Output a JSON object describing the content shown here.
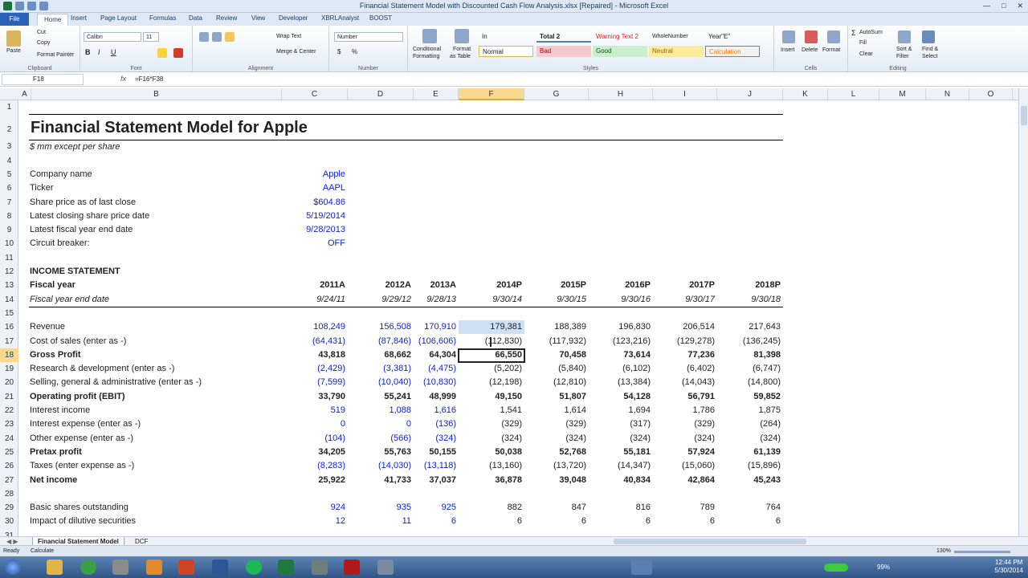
{
  "window": {
    "title": "Financial Statement Model with Discounted Cash Flow Analysis.xlsx [Repaired]  -  Microsoft Excel"
  },
  "ribbon": {
    "tabs": [
      "File",
      "Home",
      "Insert",
      "Page Layout",
      "Formulas",
      "Data",
      "Review",
      "View",
      "Developer",
      "XBRLAnalyst",
      "BOOST"
    ],
    "clipboard": {
      "paste": "Paste",
      "cut": "Cut",
      "copy": "Copy",
      "format_painter": "Format Painter",
      "label": "Clipboard"
    },
    "font": {
      "name": "Calibri",
      "size": "11",
      "label": "Font"
    },
    "alignment": {
      "wrap_text": "Wrap Text",
      "merge_center": "Merge & Center",
      "label": "Alignment"
    },
    "number": {
      "format": "Number",
      "label": "Number"
    },
    "styles": {
      "conditional": "Conditional",
      "conditional2": "Formatting",
      "format_as": "Format",
      "format_as2": "as Table",
      "style_in": "In",
      "style_total": "Total 2",
      "style_warning": "Warning Text 2",
      "style_whole": "WholeNumber",
      "style_year": "Year\"E\"",
      "style_normal": "Normal",
      "style_bad": "Bad",
      "style_good": "Good",
      "style_neutral": "Neutral",
      "style_calc": "Calculation",
      "label": "Styles"
    },
    "cells": {
      "insert": "Insert",
      "delete": "Delete",
      "format": "Format",
      "label": "Cells"
    },
    "editing": {
      "autosum": "AutoSum",
      "fill": "Fill",
      "clear": "Clear",
      "sort": "Sort &",
      "sort2": "Filter",
      "find": "Find &",
      "find2": "Select",
      "label": "Editing"
    }
  },
  "formula_bar": {
    "name_box": "F18",
    "fx": "fx",
    "formula": "=F16*F38"
  },
  "columns": [
    "A",
    "B",
    "C",
    "D",
    "E",
    "F",
    "G",
    "H",
    "I",
    "J",
    "K",
    "L",
    "M",
    "N",
    "O"
  ],
  "rows": [
    "1",
    "2",
    "3",
    "4",
    "5",
    "6",
    "7",
    "8",
    "9",
    "10",
    "11",
    "12",
    "13",
    "14",
    "15",
    "16",
    "17",
    "18",
    "19",
    "20",
    "21",
    "22",
    "23",
    "24",
    "25",
    "26",
    "27",
    "28",
    "29",
    "30",
    "31"
  ],
  "sheet": {
    "title": "Financial Statement Model for Apple",
    "subtitle": "$ mm except per share",
    "info": [
      {
        "label": "Company name",
        "value": "Apple"
      },
      {
        "label": "Ticker",
        "value": "AAPL"
      },
      {
        "label": "Share price as of last close",
        "value": "$604.86"
      },
      {
        "label": "Latest closing share price date",
        "value": "5/19/2014"
      },
      {
        "label": "Latest fiscal year end date",
        "value": "9/28/2013"
      },
      {
        "label": "Circuit breaker:",
        "value": "OFF"
      }
    ],
    "section": "INCOME STATEMENT",
    "fiscal_year_label": "Fiscal year",
    "fiscal_year_end_label": "Fiscal year end date",
    "years": [
      "2011A",
      "2012A",
      "2013A",
      "2014P",
      "2015P",
      "2016P",
      "2017P",
      "2018P"
    ],
    "year_ends": [
      "9/24/11",
      "9/29/12",
      "9/28/13",
      "9/30/14",
      "9/30/15",
      "9/30/16",
      "9/30/17",
      "9/30/18"
    ],
    "lines": [
      {
        "label": "Revenue",
        "bold": false,
        "values": [
          "108,249",
          "156,508",
          "170,910",
          "179,381",
          "188,389",
          "196,830",
          "206,514",
          "217,643"
        ]
      },
      {
        "label": "Cost of sales (enter as -)",
        "bold": false,
        "values": [
          "(64,431)",
          "(87,846)",
          "(106,606)",
          "(112,830)",
          "(117,932)",
          "(123,216)",
          "(129,278)",
          "(136,245)"
        ]
      },
      {
        "label": "Gross Profit",
        "bold": true,
        "values": [
          "43,818",
          "68,662",
          "64,304",
          "66,550",
          "70,458",
          "73,614",
          "77,236",
          "81,398"
        ]
      },
      {
        "label": "Research & development (enter as -)",
        "bold": false,
        "values": [
          "(2,429)",
          "(3,381)",
          "(4,475)",
          "(5,202)",
          "(5,840)",
          "(6,102)",
          "(6,402)",
          "(6,747)"
        ]
      },
      {
        "label": "Selling, general & administrative (enter as -)",
        "bold": false,
        "values": [
          "(7,599)",
          "(10,040)",
          "(10,830)",
          "(12,198)",
          "(12,810)",
          "(13,384)",
          "(14,043)",
          "(14,800)"
        ]
      },
      {
        "label": "Operating profit (EBIT)",
        "bold": true,
        "values": [
          "33,790",
          "55,241",
          "48,999",
          "49,150",
          "51,807",
          "54,128",
          "56,791",
          "59,852"
        ]
      },
      {
        "label": "Interest income",
        "bold": false,
        "values": [
          "519",
          "1,088",
          "1,616",
          "1,541",
          "1,614",
          "1,694",
          "1,786",
          "1,875"
        ]
      },
      {
        "label": "Interest expense (enter as -)",
        "bold": false,
        "values": [
          "0",
          "0",
          "(136)",
          "(329)",
          "(329)",
          "(317)",
          "(329)",
          "(264)"
        ]
      },
      {
        "label": "Other expense (enter as -)",
        "bold": false,
        "values": [
          "(104)",
          "(566)",
          "(324)",
          "(324)",
          "(324)",
          "(324)",
          "(324)",
          "(324)"
        ]
      },
      {
        "label": "Pretax profit",
        "bold": true,
        "values": [
          "34,205",
          "55,763",
          "50,155",
          "50,038",
          "52,768",
          "55,181",
          "57,924",
          "61,139"
        ]
      },
      {
        "label": "Taxes (enter expense as -)",
        "bold": false,
        "values": [
          "(8,283)",
          "(14,030)",
          "(13,118)",
          "(13,160)",
          "(13,720)",
          "(14,347)",
          "(15,060)",
          "(15,896)"
        ]
      },
      {
        "label": "Net income",
        "bold": true,
        "values": [
          "25,922",
          "41,733",
          "37,037",
          "36,878",
          "39,048",
          "40,834",
          "42,864",
          "45,243"
        ]
      }
    ],
    "shares": [
      {
        "label": "Basic shares outstanding",
        "values": [
          "924",
          "935",
          "925",
          "882",
          "847",
          "816",
          "789",
          "764"
        ]
      },
      {
        "label": "Impact of dilutive securities",
        "values": [
          "12",
          "11",
          "6",
          "6",
          "6",
          "6",
          "6",
          "6"
        ]
      }
    ]
  },
  "sheet_tabs": [
    "Financial Statement Model",
    "DCF"
  ],
  "status": {
    "ready": "Ready",
    "calculate": "Calculate",
    "zoom": "130%"
  },
  "taskbar": {
    "time": "12:44 PM",
    "date": "5/30/2014",
    "battery": "99%"
  },
  "colors": {
    "input_blue": "#0b1fd4",
    "selected_header": "#f9d98e",
    "selection": "#cfe0f5"
  }
}
